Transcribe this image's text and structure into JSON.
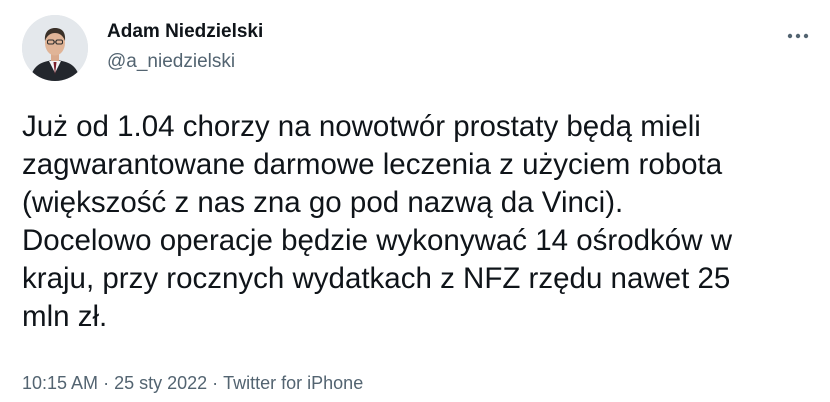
{
  "author": {
    "display_name": "Adam Niedzielski",
    "handle": "@a_niedzielski",
    "avatar_icon": "user-portrait-avatar"
  },
  "more_icon": "more-horizontal-icon",
  "tweet": {
    "text": "Już od 1.04 chorzy na nowotwór prostaty będą mieli\nzagwarantowane darmowe leczenia z użyciem robota\n(większość z nas zna go pod nazwą da Vinci).\nDocelowo operacje będzie wykonywać 14 ośrodków w\nkraju, przy rocznych wydatkach z NFZ rzędu nawet 25\nmln zł."
  },
  "meta": {
    "time": "10:15 AM",
    "separator": "·",
    "date": "25 sty 2022",
    "source": "Twitter for iPhone"
  },
  "colors": {
    "text": "#0f1419",
    "secondary": "#536471",
    "background": "#ffffff"
  }
}
